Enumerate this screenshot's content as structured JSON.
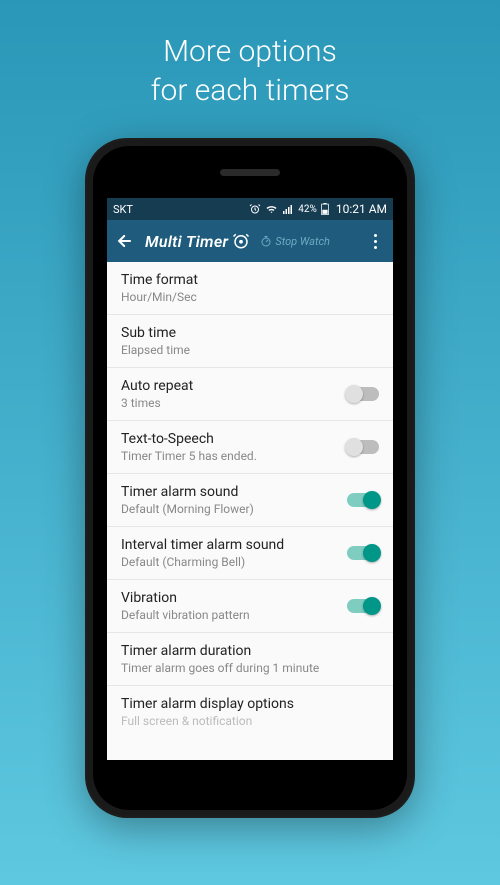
{
  "promo": {
    "line1": "More options",
    "line2": "for each timers"
  },
  "statusbar": {
    "carrier": "SKT",
    "battery_pct": "42%",
    "time": "10:21 AM"
  },
  "appbar": {
    "title": "Multi Timer",
    "sub_tab": "Stop Watch"
  },
  "settings": [
    {
      "title": "Time format",
      "sub": "Hour/Min/Sec",
      "toggle": null
    },
    {
      "title": "Sub time",
      "sub": "Elapsed time",
      "toggle": null
    },
    {
      "title": "Auto repeat",
      "sub": "3 times",
      "toggle": false
    },
    {
      "title": "Text-to-Speech",
      "sub": "Timer Timer 5 has ended.",
      "toggle": false
    },
    {
      "title": "Timer alarm sound",
      "sub": "Default (Morning Flower)",
      "toggle": true
    },
    {
      "title": "Interval timer alarm sound",
      "sub": "Default (Charming Bell)",
      "toggle": true
    },
    {
      "title": "Vibration",
      "sub": "Default vibration pattern",
      "toggle": true
    },
    {
      "title": "Timer alarm duration",
      "sub": "Timer alarm goes off during 1 minute",
      "toggle": null
    },
    {
      "title": "Timer alarm display options",
      "sub": "Full screen & notification",
      "toggle": null
    }
  ]
}
